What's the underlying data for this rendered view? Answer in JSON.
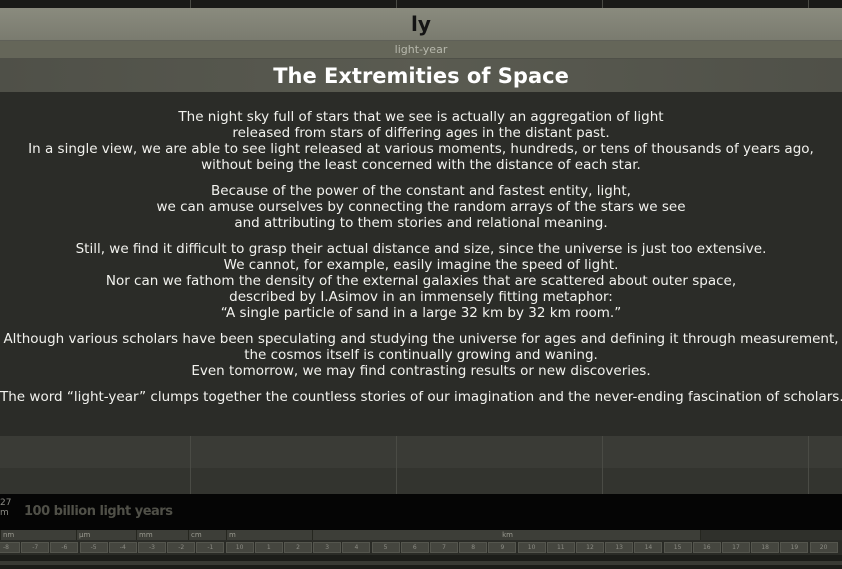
{
  "header": {
    "abbreviation": "ly",
    "unit_name": "light-year",
    "title": "The Extremities of Space"
  },
  "paragraphs": [
    {
      "lines": [
        "The night sky full of stars that we see is actually an aggregation of light",
        "released from stars of differing ages in the distant past.",
        "In a single view, we are able to see light released at various moments, hundreds, or tens of thousands of years ago,",
        "without being the least concerned with the distance of each star."
      ]
    },
    {
      "lines": [
        "Because of the power of the constant and fastest entity, light,",
        "we can amuse ourselves by connecting the random arrays of the stars we see",
        "and attributing to them stories and relational meaning."
      ]
    },
    {
      "lines": [
        "Still, we find it difficult to grasp their actual distance and size, since the universe is just too extensive.",
        "We cannot, for example, easily imagine the speed of light.",
        "Nor can we fathom the density of the external galaxies that are scattered about outer space,",
        "described by I.Asimov in an immensely fitting metaphor:",
        "“A single particle of sand in a large 32 km by 32 km room.”"
      ]
    },
    {
      "lines": [
        "Although various scholars have been speculating and studying the universe for ages and defining it through measurement,",
        "the cosmos itself is continually growing and waning.",
        "Even tomorrow, we may find contrasting results or new discoveries."
      ]
    },
    {
      "lines": [
        "The word “light-year” clumps together the countless stories of our imagination and the never-ending fascination of scholars."
      ]
    }
  ],
  "scale": {
    "exponent_top": "27",
    "exponent_unit": "m",
    "magnitude_label": "100 billion light years"
  },
  "unit_labels": [
    "nm",
    "μm",
    "mm",
    "cm",
    "m",
    "km"
  ],
  "tick_labels": [
    "-8",
    "-7",
    "-6",
    "-5",
    "-4",
    "-3",
    "-2",
    "-1",
    "10",
    "1",
    "2",
    "3",
    "4",
    "5",
    "6",
    "7",
    "8",
    "9",
    "10",
    "11",
    "12",
    "13",
    "14",
    "15",
    "16",
    "17",
    "18",
    "19",
    "20"
  ]
}
